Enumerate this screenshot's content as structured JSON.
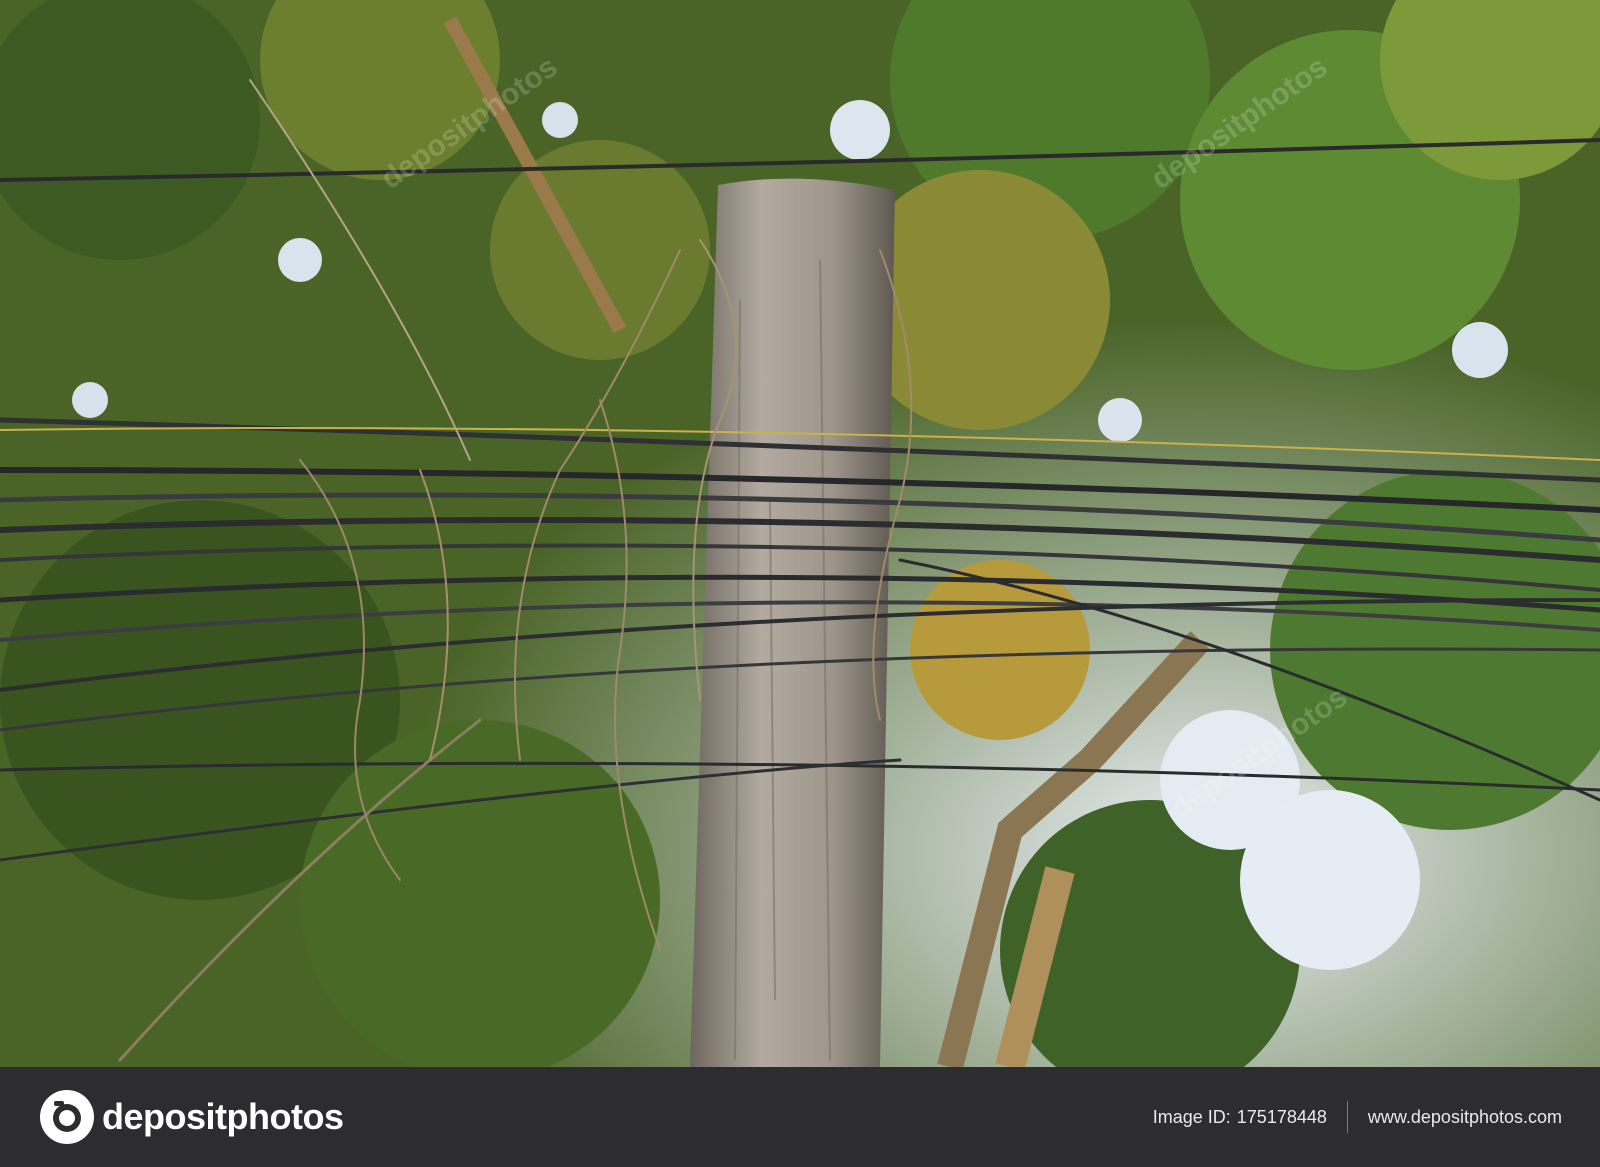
{
  "photo": {
    "subject": "utility-pole-with-tangled-wires",
    "watermark_text": "depositphotos"
  },
  "footer": {
    "logo_text": "depositphotos",
    "image_id_label": "Image ID:",
    "image_id_value": "175178448",
    "site_url": "www.depositphotos.com"
  },
  "colors": {
    "footer_bg": "#2d2d2f",
    "foliage": "#4f6a2a",
    "sky": "#dfe8f2",
    "pole": "#9a9288"
  }
}
